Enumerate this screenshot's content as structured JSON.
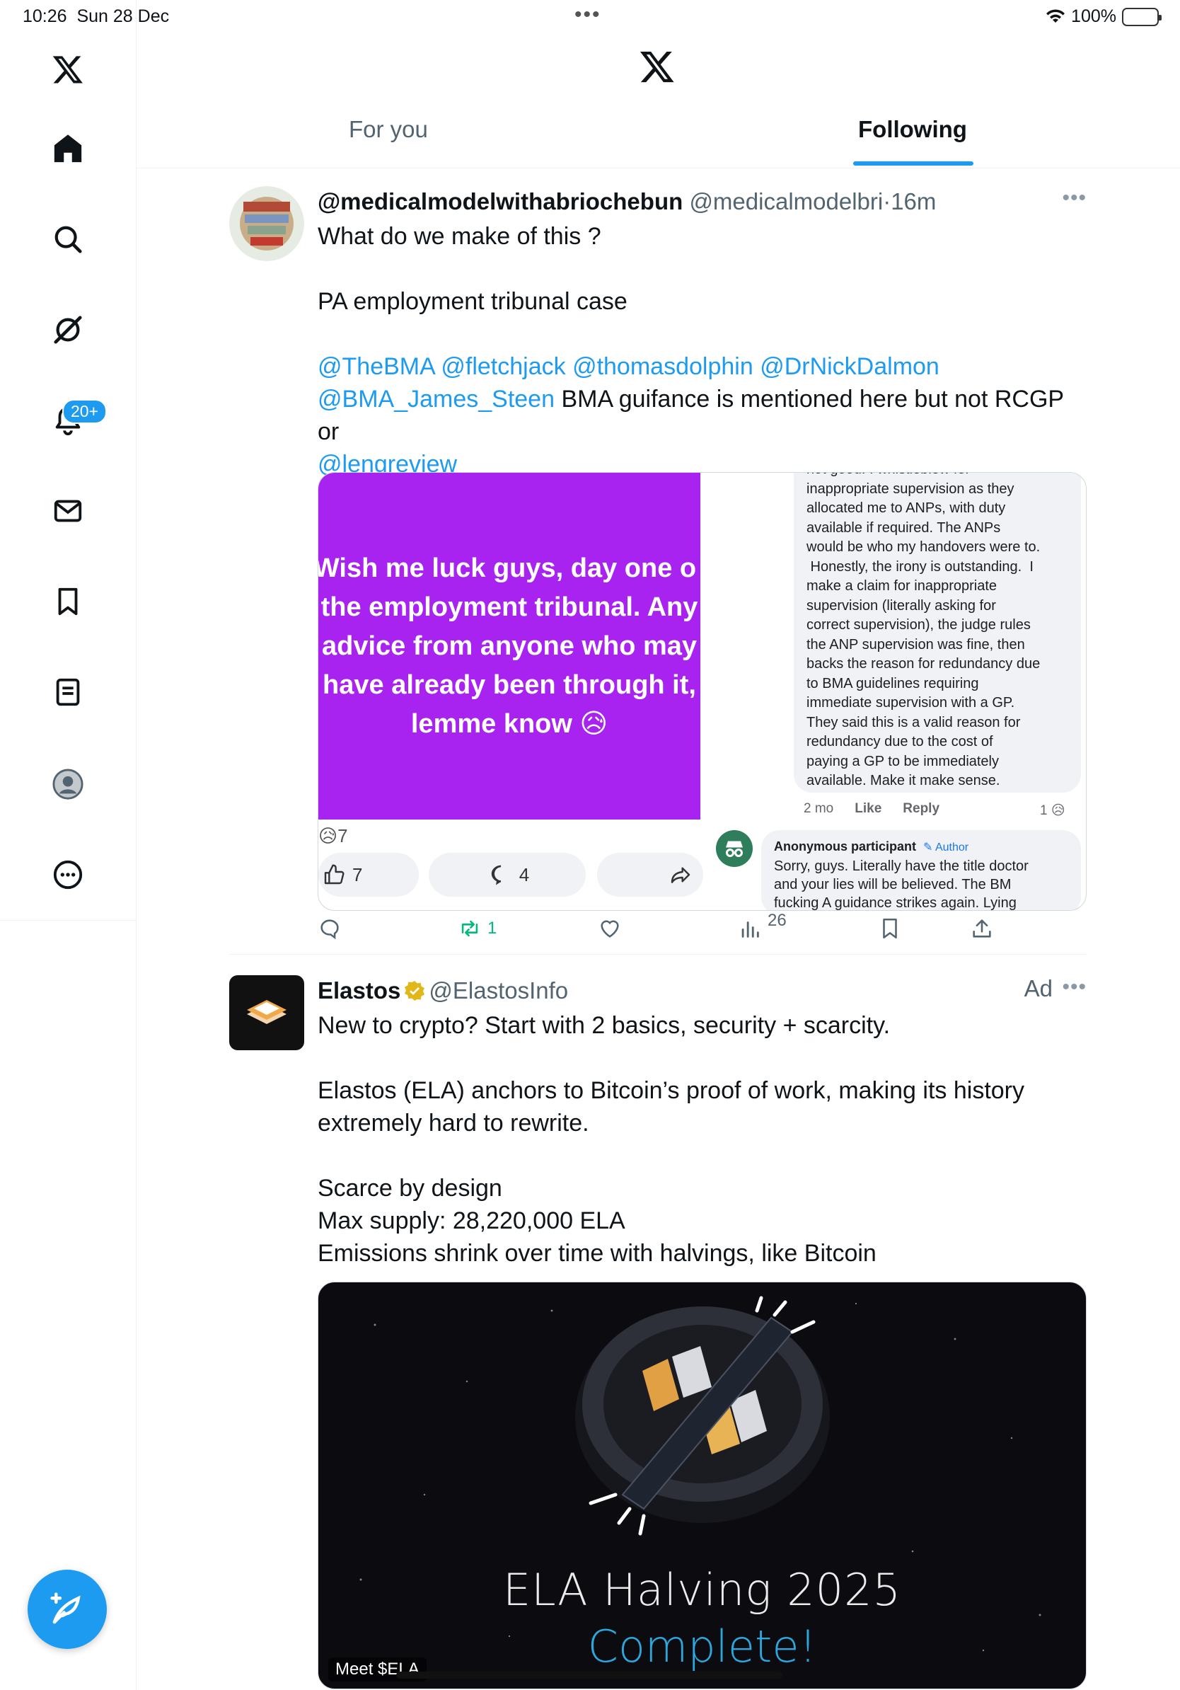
{
  "status": {
    "time": "10:26",
    "date": "Sun 28 Dec",
    "battery": "100%"
  },
  "nav": {
    "items": [
      "x-logo",
      "home",
      "search",
      "grok",
      "notifications",
      "messages",
      "bookmarks",
      "lists",
      "profile",
      "more"
    ],
    "notification_badge": "20+"
  },
  "header": {
    "tabs": [
      {
        "label": "For you",
        "selected": false
      },
      {
        "label": "Following",
        "selected": true
      }
    ]
  },
  "post1": {
    "display_name": "@medicalmodelwithabriochebun",
    "handle": "@medicalmodelbri",
    "time": "16m",
    "line1": "What do we make of this ?",
    "line2": "PA employment tribunal case",
    "mentions_row1": [
      "@TheBMA",
      "@fletchjack",
      "@thomasdolphin",
      "@DrNickDalmon"
    ],
    "mention_row2_first": "@BMA_James_Steen",
    "row2_text": "BMA guifance is mentioned here but not RCGP or",
    "mention_row3": "@lengreview",
    "media": {
      "purple_lines": [
        "Wish me luck guys, day one o",
        "the employment tribunal.  Any",
        "advice from anyone who may",
        "have already been through it,",
        "lemme know 😥"
      ],
      "reaction_count": "7",
      "like_count": "7",
      "comment_count": "4",
      "comment_lines": [
        "not good. I whistleblew for",
        "inappropriate supervision as they",
        "allocated me to ANPs, with duty",
        "available if required.  The ANPs",
        "would be who my handovers were to.",
        " Honestly, the irony is outstanding.  I",
        "make a claim for inappropriate",
        "supervision (literally asking for",
        "correct supervision), the judge rules",
        "the ANP supervision was fine, then",
        "backs the reason for redundancy due",
        "to BMA guidelines requiring",
        "immediate supervision with a GP.",
        "They said this is a valid reason for",
        "redundancy due to the cost of",
        "paying a GP to be immediately",
        "available. Make it make sense."
      ],
      "comment_age": "2 mo",
      "comment_like": "Like",
      "comment_reply": "Reply",
      "comment_reacts": "1 😥",
      "anon_name": "Anonymous participant",
      "anon_tag": "Author",
      "anon_lines": [
        "Sorry, guys.  Literally have the title doctor",
        "and your lies will be believed.  The BM",
        "fucking A guidance strikes again. Lying"
      ]
    },
    "actions": {
      "reposts": "1",
      "views": "26"
    }
  },
  "post2": {
    "display_name": "Elastos",
    "handle": "@ElastosInfo",
    "ad_label": "Ad",
    "lines": [
      "New to crypto? Start with 2 basics, security + scarcity.",
      "",
      "Elastos (ELA) anchors to Bitcoin’s proof of work, making its history",
      "extremely hard to rewrite.",
      "",
      "Scarce by design",
      "Max supply: 28,220,000 ELA",
      "Emissions shrink over time with halvings, like Bitcoin"
    ],
    "media": {
      "title": "ELA Halving 2025",
      "subtitle": "Complete!",
      "tag": "Meet $ELA"
    }
  },
  "colors": {
    "accent": "#1d9bf0",
    "purple": "#a823ef",
    "repost_green": "#00ba7c"
  }
}
